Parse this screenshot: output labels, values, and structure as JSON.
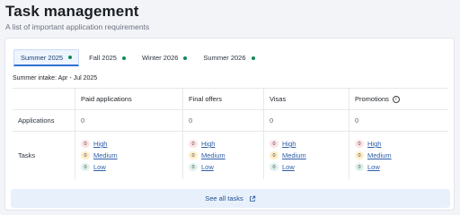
{
  "page": {
    "title": "Task management",
    "subtitle": "A list of important application requirements"
  },
  "tabs": [
    {
      "label": "Summer 2025",
      "active": true
    },
    {
      "label": "Fall 2025",
      "active": false
    },
    {
      "label": "Winter 2026",
      "active": false
    },
    {
      "label": "Summer 2026",
      "active": false
    }
  ],
  "intake": "Summer intake: Apr - Jul 2025",
  "table": {
    "columns": [
      "",
      "Paid applications",
      "Final offers",
      "Visas",
      "Promotions"
    ],
    "applications_label": "Applications",
    "applications": [
      "0",
      "0",
      "0",
      "0"
    ],
    "tasks_label": "Tasks",
    "tasks": [
      [
        {
          "count": "0",
          "label": "High"
        },
        {
          "count": "0",
          "label": "Medium"
        },
        {
          "count": "0",
          "label": "Low"
        }
      ],
      [
        {
          "count": "0",
          "label": "High"
        },
        {
          "count": "0",
          "label": "Medium"
        },
        {
          "count": "0",
          "label": "Low"
        }
      ],
      [
        {
          "count": "0",
          "label": "High"
        },
        {
          "count": "0",
          "label": "Medium"
        },
        {
          "count": "0",
          "label": "Low"
        }
      ],
      [
        {
          "count": "0",
          "label": "High"
        },
        {
          "count": "0",
          "label": "Medium"
        },
        {
          "count": "0",
          "label": "Low"
        }
      ]
    ]
  },
  "see_all_label": "See all tasks",
  "colors": {
    "tab_dot": "#0f8a58",
    "accent": "#2f6fd0",
    "link": "#2f5fa8"
  }
}
